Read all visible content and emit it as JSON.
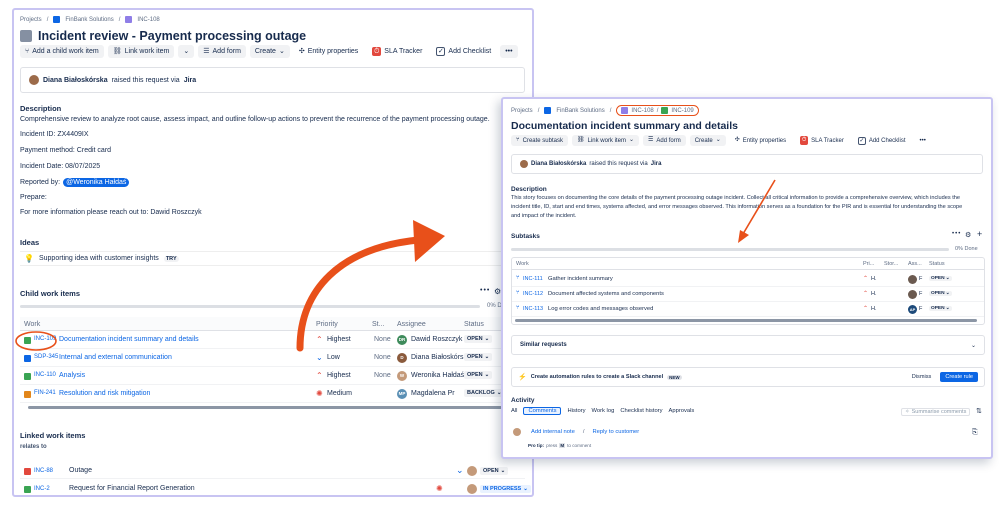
{
  "left": {
    "breadcrumb": {
      "projects": "Projects",
      "sep": "/",
      "project": "FinBank Solutions",
      "issue": "INC-108"
    },
    "title": "Incident review - Payment processing outage",
    "toolbar": {
      "child": "Add a child work item",
      "link": "Link work item",
      "form": "Add form",
      "create": "Create",
      "entity": "Entity properties",
      "sla": "SLA Tracker",
      "checklist": "Add Checklist",
      "more": "•••"
    },
    "requester": {
      "name": "Diana Białoskórska",
      "action": "raised this request via",
      "via": "Jira"
    },
    "description": {
      "heading": "Description",
      "text": "Comprehensive review to analyze root cause, assess impact, and outline follow-up actions to prevent the recurrence of the payment processing outage.",
      "incident": "Incident ID: ZX4409IX",
      "payment": "Payment method: Credit card",
      "date": "Incident Date: 08/07/2025",
      "reported_label": "Reported by:",
      "reported_user": "@Weronika Hałdaś",
      "prepare": "Prepare:",
      "contact": "For more information please reach out to: Dawid Roszczyk"
    },
    "ideas": {
      "heading": "Ideas",
      "item": "Supporting idea with customer insights",
      "badge": "TRY"
    },
    "child": {
      "heading": "Child work items",
      "percent": "0% D",
      "cols": [
        "Work",
        "Priority",
        "St...",
        "Assignee",
        "Status"
      ],
      "rows": [
        {
          "key": "INC-109",
          "summary": "Documentation incident summary and details",
          "priority": "Highest",
          "story": "None",
          "assignee": "Dawid Roszczyk",
          "initials": "DR",
          "status": "OPEN",
          "icon": "#3aa453",
          "avc": "#3e8b5b",
          "pc": "#e2483d",
          "pi": "⌃"
        },
        {
          "key": "SDP-345",
          "summary": "Internal and external communication",
          "priority": "Low",
          "story": "None",
          "assignee": "Diana Białoskórs",
          "initials": "D",
          "status": "OPEN",
          "icon": "#0c66e4",
          "avc": "#8a5a3c",
          "pc": "#0c66e4",
          "pi": "⌄"
        },
        {
          "key": "INC-110",
          "summary": "Analysis",
          "priority": "Highest",
          "story": "None",
          "assignee": "Weronika Hałdaś",
          "initials": "W",
          "status": "OPEN",
          "icon": "#3aa453",
          "avc": "#c49a7a",
          "pc": "#e2483d",
          "pi": "⌃"
        },
        {
          "key": "FIN-241",
          "summary": "Resolution and risk mitigation",
          "priority": "Medium",
          "story": "",
          "assignee": "Magdalena Pr",
          "initials": "MP",
          "status": "BACKLOG",
          "icon": "#e2861a",
          "avc": "#5a8fb4",
          "pc": "#e2483d",
          "pi": "✺"
        }
      ]
    },
    "linked": {
      "heading": "Linked work items",
      "relates": "relates to",
      "rows": [
        {
          "key": "INC-88",
          "summary": "Outage",
          "status": "OPEN",
          "icon": "#e2483d"
        },
        {
          "key": "INC-2",
          "summary": "Request for Financial Report Generation",
          "status": "IN PROGRESS",
          "icon": "#3aa453"
        }
      ]
    }
  },
  "right": {
    "breadcrumb": {
      "projects": "Projects",
      "sep": "/",
      "project": "FinBank Solutions",
      "issue1": "INC-108",
      "issue2": "INC-109"
    },
    "title": "Documentation incident summary and details",
    "toolbar": {
      "subtask": "Create subtask",
      "link": "Link work item",
      "form": "Add form",
      "create": "Create",
      "entity": "Entity properties",
      "sla": "SLA Tracker",
      "checklist": "Add Checklist",
      "more": "•••"
    },
    "requester": {
      "name": "Diana Białoskórska",
      "action": "raised this request via",
      "via": "Jira"
    },
    "description": {
      "heading": "Description",
      "line1": "This story focuses on documenting the core details of the payment processing outage incident. Collect all critical information to provide a comprehensive overview, which includes the",
      "line2": "incident title, ID, start and end times, systems affected, and error messages observed. This information serves as a foundation for the PIR and is essential for understanding the scope",
      "line3": "and impact of the incident."
    },
    "subtasks": {
      "heading": "Subtasks",
      "done": "0% Done",
      "cols": [
        "Work",
        "Pri...",
        "Stor...",
        "Ass...",
        "Status"
      ],
      "rows": [
        {
          "key": "INC-111",
          "summary": "Gather incident summary",
          "priority": "H.",
          "ass": "F",
          "initials": "",
          "status": "OPEN"
        },
        {
          "key": "INC-112",
          "summary": "Document affected systems and components",
          "priority": "H.",
          "ass": "F",
          "initials": "",
          "status": "OPEN"
        },
        {
          "key": "INC-113",
          "summary": "Log error codes and messages observed",
          "priority": "H.",
          "ass": "F",
          "initials": "AP",
          "status": "OPEN"
        }
      ]
    },
    "similar": "Similar requests",
    "automation": {
      "text": "Create automation rules to create a Slack channel",
      "badge": "NEW",
      "dismiss": "Dismiss",
      "create": "Create rule"
    },
    "activity": {
      "heading": "Activity",
      "tabs": [
        "All",
        "Comments",
        "History",
        "Work log",
        "Checklist history",
        "Approvals"
      ],
      "summarise": "Summarise comments",
      "internal": "Add internal note",
      "sep": "/",
      "reply": "Reply to customer",
      "protip": "Pro tip:",
      "press": "press",
      "key": "M",
      "tocomment": "to comment"
    }
  },
  "colors": {
    "accent": "#0c66e4",
    "annotation": "#e8501a",
    "panel_border": "#c8c4f2"
  }
}
